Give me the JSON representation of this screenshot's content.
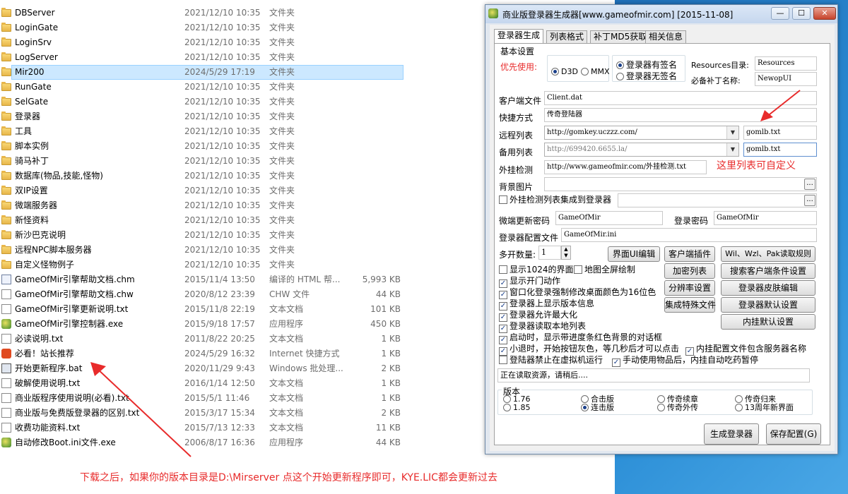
{
  "files": [
    {
      "name": "DBServer",
      "date": "2021/12/10 10:35",
      "type": "文件夹",
      "size": "",
      "icon": "folder-icon"
    },
    {
      "name": "LoginGate",
      "date": "2021/12/10 10:35",
      "type": "文件夹",
      "size": "",
      "icon": "folder-icon"
    },
    {
      "name": "LoginSrv",
      "date": "2021/12/10 10:35",
      "type": "文件夹",
      "size": "",
      "icon": "folder-icon"
    },
    {
      "name": "LogServer",
      "date": "2021/12/10 10:35",
      "type": "文件夹",
      "size": "",
      "icon": "folder-icon"
    },
    {
      "name": "Mir200",
      "date": "2024/5/29 17:19",
      "type": "文件夹",
      "size": "",
      "icon": "folder-icon",
      "selected": true
    },
    {
      "name": "RunGate",
      "date": "2021/12/10 10:35",
      "type": "文件夹",
      "size": "",
      "icon": "folder-icon"
    },
    {
      "name": "SelGate",
      "date": "2021/12/10 10:35",
      "type": "文件夹",
      "size": "",
      "icon": "folder-icon"
    },
    {
      "name": "登录器",
      "date": "2021/12/10 10:35",
      "type": "文件夹",
      "size": "",
      "icon": "folder-icon"
    },
    {
      "name": "工具",
      "date": "2021/12/10 10:35",
      "type": "文件夹",
      "size": "",
      "icon": "folder-icon"
    },
    {
      "name": "脚本实例",
      "date": "2021/12/10 10:35",
      "type": "文件夹",
      "size": "",
      "icon": "folder-icon"
    },
    {
      "name": "骑马补丁",
      "date": "2021/12/10 10:35",
      "type": "文件夹",
      "size": "",
      "icon": "folder-icon"
    },
    {
      "name": "数据库(物品,技能,怪物)",
      "date": "2021/12/10 10:35",
      "type": "文件夹",
      "size": "",
      "icon": "folder-icon"
    },
    {
      "name": "双IP设置",
      "date": "2021/12/10 10:35",
      "type": "文件夹",
      "size": "",
      "icon": "folder-icon"
    },
    {
      "name": "微端服务器",
      "date": "2021/12/10 10:35",
      "type": "文件夹",
      "size": "",
      "icon": "folder-icon"
    },
    {
      "name": "新怪资料",
      "date": "2021/12/10 10:35",
      "type": "文件夹",
      "size": "",
      "icon": "folder-icon"
    },
    {
      "name": "新沙巴克说明",
      "date": "2021/12/10 10:35",
      "type": "文件夹",
      "size": "",
      "icon": "folder-icon"
    },
    {
      "name": "远程NPC脚本服务器",
      "date": "2021/12/10 10:35",
      "type": "文件夹",
      "size": "",
      "icon": "folder-icon"
    },
    {
      "name": "自定义怪物例子",
      "date": "2021/12/10 10:35",
      "type": "文件夹",
      "size": "",
      "icon": "folder-icon"
    },
    {
      "name": "GameOfMir引擎帮助文档.chm",
      "date": "2015/11/4 13:50",
      "type": "编译的 HTML 帮...",
      "size": "5,993 KB",
      "icon": "chm-file-icon"
    },
    {
      "name": "GameOfMir引擎帮助文档.chw",
      "date": "2020/8/12 23:39",
      "type": "CHW 文件",
      "size": "44 KB",
      "icon": "document-icon"
    },
    {
      "name": "GameOfMir引擎更新说明.txt",
      "date": "2015/11/8 22:19",
      "type": "文本文档",
      "size": "101 KB",
      "icon": "document-icon"
    },
    {
      "name": "GameOfMir引擎控制器.exe",
      "date": "2015/9/18 17:57",
      "type": "应用程序",
      "size": "450 KB",
      "icon": "exe-icon"
    },
    {
      "name": "必读说明.txt",
      "date": "2011/8/22 20:25",
      "type": "文本文档",
      "size": "1 KB",
      "icon": "document-icon"
    },
    {
      "name": "必看！站长推荐",
      "date": "2024/5/29 16:32",
      "type": "Internet 快捷方式",
      "size": "1 KB",
      "icon": "shortcut-icon"
    },
    {
      "name": "开始更新程序.bat",
      "date": "2020/11/29 9:43",
      "type": "Windows 批处理...",
      "size": "2 KB",
      "icon": "bat-icon"
    },
    {
      "name": "破解使用说明.txt",
      "date": "2016/1/14 12:50",
      "type": "文本文档",
      "size": "1 KB",
      "icon": "document-icon"
    },
    {
      "name": "商业版程序使用说明(必看).txt",
      "date": "2015/5/1 11:46",
      "type": "文本文档",
      "size": "1 KB",
      "icon": "document-icon"
    },
    {
      "name": "商业版与免费版登录器的区别.txt",
      "date": "2015/3/17 15:34",
      "type": "文本文档",
      "size": "2 KB",
      "icon": "document-icon"
    },
    {
      "name": "收费功能资料.txt",
      "date": "2015/7/13 12:33",
      "type": "文本文档",
      "size": "11 KB",
      "icon": "document-icon"
    },
    {
      "name": "自动修改Boot.ini文件.exe",
      "date": "2006/8/17 16:36",
      "type": "应用程序",
      "size": "44 KB",
      "icon": "exe-icon"
    }
  ],
  "footnote": "下载之后，如果你的版本目录是D:\\Mirserver 点这个开始更新程序即可，KYE.LIC都会更新过去",
  "annotation": "这里列表可自定义",
  "colors": {
    "accent_red": "#e82b2b",
    "selection": "#cce8ff"
  },
  "dialog": {
    "title": "商业版登录器生成器[www.gameofmir.com] [2015-11-08]",
    "minimize": "—",
    "maximize": "☐",
    "close": "✕",
    "tabs": [
      "登录器生成",
      "列表格式",
      "补丁MD5获取",
      "相关信息"
    ],
    "basic_settings": "基本设置",
    "prefer_label": "优先使用:",
    "render_options": [
      "D3D",
      "MMX"
    ],
    "sign_options": [
      "登录器有签名",
      "登录器无签名"
    ],
    "resources_label": "Resources目录:",
    "resources_value": "Resources",
    "patch_label": "必备补丁名称:",
    "patch_value": "NewopUI",
    "client_file_label": "客户端文件",
    "client_file_value": "Client.dat",
    "shortcut_label": "快捷方式",
    "shortcut_value": "传奇登陆器",
    "remote_list_label": "远程列表",
    "remote_list_value": "http://gomkey.uczzz.com/",
    "remote_list_file": "gomlb.txt",
    "backup_list_label": "备用列表",
    "backup_list_value": "http://699420.6655.la/",
    "backup_list_file": "gomlb.txt",
    "plugin_check_label": "外挂检测",
    "plugin_check_value": "http://www.gameofmir.com/外挂检测.txt",
    "bg_image_label": "背景图片",
    "bg_image_value": "",
    "browse": "...",
    "plugin_integrate_label": "外挂检测列表集成到登录器",
    "micro_pwd_label": "微端更新密码",
    "micro_pwd_value": "GameOfMir",
    "login_pwd_label": "登录密码",
    "login_pwd_value": "GameOfMir",
    "config_file_label": "登录器配置文件",
    "config_file_value": "GameOfMir.ini",
    "multi_open_label": "多开数量:",
    "multi_open_value": "1",
    "buttons": {
      "ui_edit": "界面UI编辑",
      "client_plugin": "客户端插件",
      "wil_rules": "Wil、Wzl、Pak读取规则",
      "encrypt_list": "加密列表",
      "search_client": "搜索客户端条件设置",
      "resolution": "分辨率设置",
      "skin_edit": "登录器皮肤编辑",
      "integrate_special": "集成特殊文件",
      "default_settings": "登录器默认设置",
      "plugin_default": "内挂默认设置",
      "generate": "生成登录器",
      "save": "保存配置(G)"
    },
    "checks": [
      {
        "label": "显示1024的界面",
        "checked": false
      },
      {
        "label": "地图全屏绘制",
        "checked": false
      },
      {
        "label": "显示开门动作",
        "checked": true
      },
      {
        "label": "窗口化登录强制修改桌面颜色为16位色",
        "checked": true
      },
      {
        "label": "登录器上显示版本信息",
        "checked": true
      },
      {
        "label": "登录器允许最大化",
        "checked": true
      },
      {
        "label": "登录器读取本地列表",
        "checked": true
      },
      {
        "label": "启动时，显示带进度条红色背景的对话框",
        "checked": true
      },
      {
        "label": "小退时，开始按钮灰色，等几秒后才可以点击",
        "checked": true
      },
      {
        "label": "内挂配置文件包含服务器名称",
        "checked": true
      },
      {
        "label": "登陆器禁止在虚拟机运行",
        "checked": false
      },
      {
        "label": "手动使用物品后，内挂自动吃药暂停",
        "checked": true
      }
    ],
    "status": "正在读取资源，请稍后....",
    "version_label": "版本",
    "versions": [
      {
        "label": "1.76",
        "selected": false
      },
      {
        "label": "1.85",
        "selected": false
      },
      {
        "label": "合击版",
        "selected": false
      },
      {
        "label": "连击版",
        "selected": true
      },
      {
        "label": "传奇续章",
        "selected": false
      },
      {
        "label": "传奇外传",
        "selected": false
      },
      {
        "label": "传奇归来",
        "selected": false
      },
      {
        "label": "13周年新界面",
        "selected": false
      }
    ]
  }
}
